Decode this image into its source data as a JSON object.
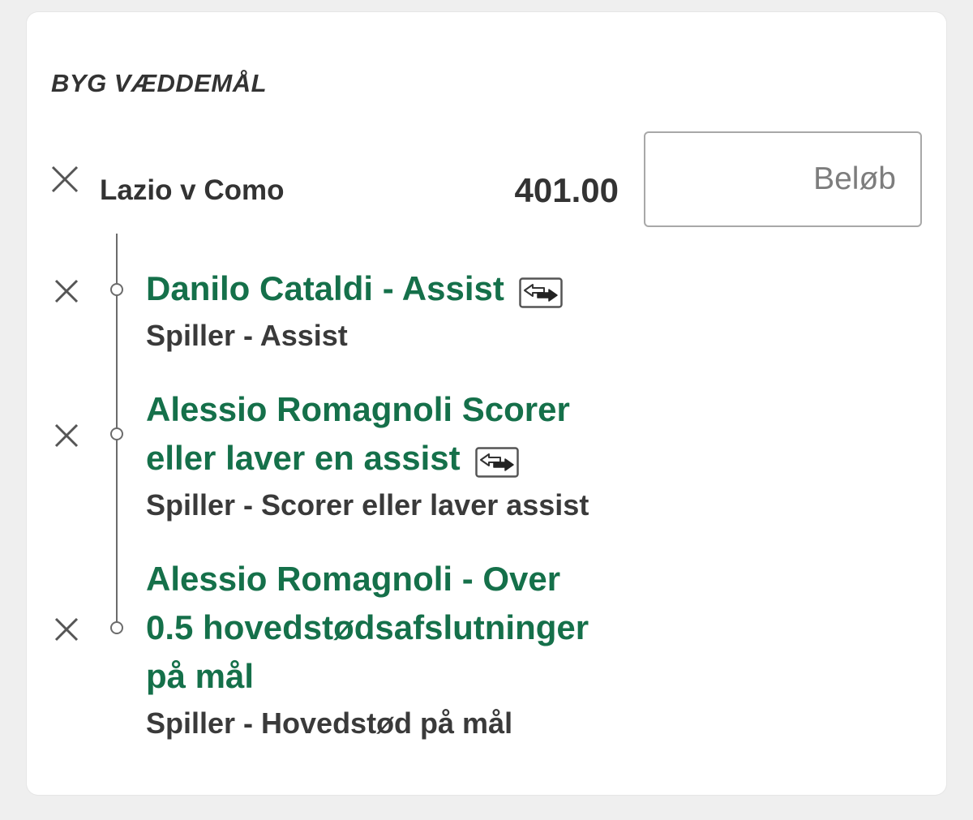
{
  "header": {
    "title": "BYG VÆDDEMÅL"
  },
  "event": {
    "name": "Lazio v Como",
    "odds": "401.00"
  },
  "stake": {
    "placeholder": "Beløb",
    "value": ""
  },
  "selections": [
    {
      "title": "Danilo Cataldi - Assist",
      "subtitle": "Spiller - Assist",
      "has_swap_icon": true
    },
    {
      "title_line1": "Alessio Romagnoli Scorer",
      "title_line2": "eller laver en assist",
      "subtitle": "Spiller - Scorer eller laver assist",
      "has_swap_icon": true
    },
    {
      "title_line1": "Alessio Romagnoli - Over",
      "title_line2": "0.5 hovedstødsafslutninger",
      "title_line3": "på mål",
      "subtitle": "Spiller - Hovedstød på mål",
      "has_swap_icon": false
    }
  ],
  "icons": {
    "close": "close-icon",
    "swap": "swap-icon"
  },
  "colors": {
    "selection_title": "#15704a",
    "text_dark": "#333333",
    "background": "#efefef",
    "card": "#ffffff"
  }
}
